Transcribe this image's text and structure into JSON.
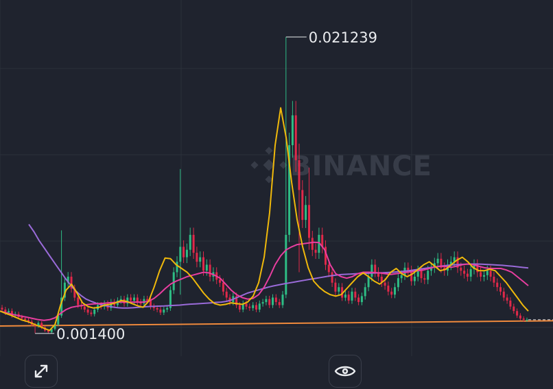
{
  "watermark": {
    "brand": "BINANCE"
  },
  "controls": {
    "expand_icon": "expand-arrows-icon",
    "visibility_icon": "eye-icon"
  },
  "colors": {
    "background": "#1f232e",
    "grid": "#2b303b",
    "up": "#2ebd85",
    "down": "#e0294a",
    "ma_short": "#f0b90b",
    "ma_mid": "#e93ea0",
    "ma_long": "#9a6bd9",
    "support_line": "#f08a3c",
    "label": "#eaecef"
  },
  "chart_data": {
    "type": "candlestick",
    "title": "",
    "ylim": [
      0.0008,
      0.0228
    ],
    "annotations": {
      "high": {
        "value": 0.021239,
        "label": "0.021239"
      },
      "low": {
        "value": 0.0014,
        "label": "0.001400"
      }
    },
    "support_line": {
      "start": 0.0019,
      "end": 0.00225
    },
    "last_price": 0.00232,
    "spikes": [
      {
        "index": 18,
        "high": 0.0083,
        "low": 0.0025
      },
      {
        "index": 54,
        "high": 0.0124,
        "low": 0.004
      },
      {
        "index": 86,
        "high": 0.021239,
        "low": 0.007
      },
      {
        "index": 90,
        "high": 0.0141,
        "low": 0.0055
      },
      {
        "index": 93,
        "high": 0.0125,
        "low": 0.007
      }
    ],
    "close": [
      0.003,
      0.0028,
      0.0029,
      0.0026,
      0.0027,
      0.0025,
      0.0024,
      0.0023,
      0.0022,
      0.002,
      0.0019,
      0.0021,
      0.0018,
      0.0016,
      0.0015,
      0.0017,
      0.002,
      0.0026,
      0.0038,
      0.0048,
      0.0052,
      0.0044,
      0.0038,
      0.0033,
      0.0032,
      0.003,
      0.0028,
      0.0027,
      0.003,
      0.0033,
      0.0032,
      0.0034,
      0.0031,
      0.0035,
      0.0033,
      0.0036,
      0.0037,
      0.0034,
      0.0038,
      0.0036,
      0.0038,
      0.0035,
      0.0034,
      0.0037,
      0.0036,
      0.0032,
      0.0031,
      0.003,
      0.0028,
      0.003,
      0.0031,
      0.0043,
      0.0055,
      0.0062,
      0.0072,
      0.0065,
      0.007,
      0.008,
      0.0068,
      0.0062,
      0.0065,
      0.0056,
      0.006,
      0.0052,
      0.0055,
      0.005,
      0.0048,
      0.0042,
      0.0038,
      0.0035,
      0.0039,
      0.0033,
      0.003,
      0.0034,
      0.0032,
      0.0031,
      0.0033,
      0.003,
      0.0034,
      0.0035,
      0.0037,
      0.0033,
      0.0038,
      0.0035,
      0.0033,
      0.004,
      0.008,
      0.014,
      0.016,
      0.013,
      0.011,
      0.009,
      0.01,
      0.0078,
      0.007,
      0.0068,
      0.008,
      0.0072,
      0.006,
      0.0055,
      0.0048,
      0.0042,
      0.0045,
      0.0038,
      0.004,
      0.0036,
      0.0042,
      0.0038,
      0.0035,
      0.0039,
      0.0045,
      0.0052,
      0.006,
      0.0055,
      0.0052,
      0.0048,
      0.0046,
      0.0042,
      0.004,
      0.0045,
      0.0051,
      0.0053,
      0.0058,
      0.0056,
      0.0049,
      0.0052,
      0.0056,
      0.0051,
      0.005,
      0.0056,
      0.0058,
      0.0061,
      0.0064,
      0.0058,
      0.0056,
      0.006,
      0.0062,
      0.0065,
      0.0058,
      0.0056,
      0.0054,
      0.0052,
      0.0057,
      0.006,
      0.0055,
      0.0052,
      0.0053,
      0.0056,
      0.0052,
      0.0048,
      0.0045,
      0.0042,
      0.0038,
      0.0036,
      0.0032,
      0.0029,
      0.0026,
      0.0024,
      0.00232,
      0.00232
    ],
    "ma_short": [
      0.0029,
      0.00275,
      0.00262,
      0.00246,
      0.0023,
      0.0022,
      0.00205,
      0.0019,
      0.00175,
      0.0016,
      0.002,
      0.0033,
      0.0043,
      0.0047,
      0.0041,
      0.00345,
      0.0032,
      0.0031,
      0.00315,
      0.0033,
      0.00335,
      0.00345,
      0.0036,
      0.00355,
      0.0034,
      0.00325,
      0.00315,
      0.00355,
      0.0045,
      0.0056,
      0.00645,
      0.0064,
      0.006,
      0.00575,
      0.0055,
      0.0051,
      0.0046,
      0.0041,
      0.0037,
      0.0034,
      0.0033,
      0.00335,
      0.00345,
      0.0034,
      0.00335,
      0.0035,
      0.0039,
      0.0048,
      0.0065,
      0.0095,
      0.014,
      0.0165,
      0.0145,
      0.0115,
      0.009,
      0.0072,
      0.0058,
      0.0049,
      0.0045,
      0.0042,
      0.004,
      0.0039,
      0.004,
      0.0044,
      0.0048,
      0.0052,
      0.00545,
      0.0052,
      0.0049,
      0.0047,
      0.005,
      0.0055,
      0.00575,
      0.0054,
      0.0052,
      0.0054,
      0.0057,
      0.006,
      0.0062,
      0.0059,
      0.0056,
      0.0057,
      0.006,
      0.0063,
      0.0065,
      0.0062,
      0.0058,
      0.0056,
      0.0056,
      0.0057,
      0.0056,
      0.0052,
      0.0048,
      0.0043,
      0.0038,
      0.0033,
      0.0029
    ],
    "ma_mid": [
      0.0029,
      0.0028,
      0.0027,
      0.00262,
      0.00255,
      0.00248,
      0.0024,
      0.00232,
      0.00228,
      0.00232,
      0.00245,
      0.00275,
      0.003,
      0.00315,
      0.00322,
      0.00328,
      0.00334,
      0.00338,
      0.0034,
      0.00342,
      0.00346,
      0.00348,
      0.0035,
      0.0035,
      0.0035,
      0.0035,
      0.0035,
      0.00355,
      0.00375,
      0.00405,
      0.0044,
      0.0047,
      0.0049,
      0.00505,
      0.0052,
      0.0053,
      0.0054,
      0.0055,
      0.00545,
      0.0053,
      0.0051,
      0.0047,
      0.0043,
      0.004,
      0.0038,
      0.0037,
      0.00375,
      0.004,
      0.0045,
      0.0052,
      0.006,
      0.0066,
      0.007,
      0.0072,
      0.00735,
      0.0074,
      0.00745,
      0.0075,
      0.00748,
      0.007,
      0.006,
      0.0054,
      0.0052,
      0.0051,
      0.0052,
      0.0054,
      0.0055,
      0.0055,
      0.00548,
      0.00545,
      0.0054,
      0.00535,
      0.0054,
      0.00545,
      0.0055,
      0.00555,
      0.0056,
      0.00565,
      0.00575,
      0.00585,
      0.0059,
      0.00588,
      0.00583,
      0.0059,
      0.006,
      0.00605,
      0.006,
      0.0059,
      0.0058,
      0.00575,
      0.00575,
      0.00575,
      0.00565,
      0.0055,
      0.0052,
      0.0049,
      0.0046
    ],
    "ma_long": [
      0.0087,
      0.0082,
      0.0076,
      0.0071,
      0.0066,
      0.0061,
      0.0056,
      0.0051,
      0.00465,
      0.00425,
      0.00395,
      0.0037,
      0.00355,
      0.00342,
      0.00332,
      0.00324,
      0.00318,
      0.00313,
      0.0031,
      0.0031,
      0.00312,
      0.00315,
      0.00318,
      0.0032,
      0.00322,
      0.00323,
      0.00324,
      0.00326,
      0.00328,
      0.0033,
      0.00333,
      0.00336,
      0.00338,
      0.0034,
      0.00342,
      0.00345,
      0.00348,
      0.0035,
      0.00355,
      0.00365,
      0.0038,
      0.00395,
      0.0041,
      0.0042,
      0.0043,
      0.0044,
      0.0045,
      0.00458,
      0.00465,
      0.00472,
      0.00478,
      0.00484,
      0.0049,
      0.00496,
      0.00502,
      0.00508,
      0.00514,
      0.0052,
      0.00526,
      0.0053,
      0.00534,
      0.00536,
      0.00538,
      0.0054,
      0.00542,
      0.00543,
      0.00544,
      0.00545,
      0.00546,
      0.00548,
      0.0055,
      0.00553,
      0.00556,
      0.0056,
      0.00565,
      0.0057,
      0.00575,
      0.0058,
      0.00585,
      0.0059,
      0.00594,
      0.00598,
      0.006,
      0.00602,
      0.00604,
      0.00605,
      0.00605,
      0.00604,
      0.00602,
      0.006,
      0.00598,
      0.00596,
      0.00593,
      0.0059,
      0.00586,
      0.00582,
      0.00578
    ]
  }
}
